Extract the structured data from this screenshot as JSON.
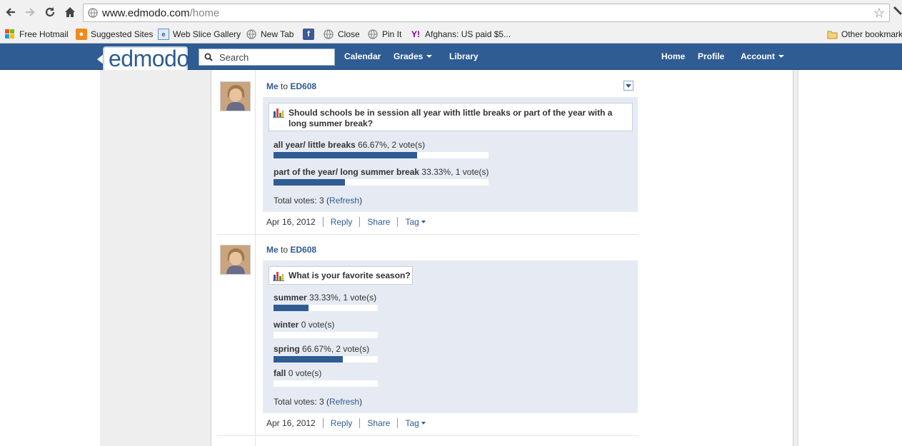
{
  "browser": {
    "url_host": "www.edmodo.com",
    "url_path": "/home",
    "bookmarks": [
      {
        "label": "Free Hotmail",
        "icon": "windows-icon"
      },
      {
        "label": "Suggested Sites",
        "icon": "suggested-sites-icon"
      },
      {
        "label": "Web Slice Gallery",
        "icon": "web-slice-icon"
      },
      {
        "label": "New Tab",
        "icon": "globe-icon"
      },
      {
        "label": "",
        "icon": "facebook-icon"
      },
      {
        "label": "Close",
        "icon": "globe-icon"
      },
      {
        "label": "Pin It",
        "icon": "globe-icon"
      },
      {
        "label": "Afghans: US paid $5...",
        "icon": "yahoo-icon"
      }
    ],
    "other_bookmarks": "Other bookmarks"
  },
  "header": {
    "logo": "edmodo",
    "search_placeholder": "Search",
    "nav_left": [
      "Calendar",
      "Grades",
      "Library"
    ],
    "nav_right": [
      "Home",
      "Profile",
      "Account"
    ]
  },
  "posts": [
    {
      "sender": "Me",
      "to_word": "to",
      "group": "ED608",
      "question": "Should schools be in session all year with little breaks or part of the year with a long summer break?",
      "options": [
        {
          "label": "all year/ little breaks",
          "stat": "66.67%, 2 vote(s)",
          "fraction": 0.6667
        },
        {
          "label": "part of the year/ long summer break",
          "stat": "33.33%, 1 vote(s)",
          "fraction": 0.3333
        }
      ],
      "total_prefix": "Total votes: 3 (",
      "refresh": "Refresh",
      "total_suffix": ")",
      "date": "Apr 16, 2012",
      "reply": "Reply",
      "share": "Share",
      "tag": "Tag"
    },
    {
      "sender": "Me",
      "to_word": "to",
      "group": "ED608",
      "question": "What is your favorite season?",
      "options": [
        {
          "label": "summer",
          "stat": "33.33%, 1 vote(s)",
          "fraction": 0.3333
        },
        {
          "label": "winter",
          "stat": "0 vote(s)",
          "fraction": 0
        },
        {
          "label": "spring",
          "stat": "66.67%, 2 vote(s)",
          "fraction": 0.6667
        },
        {
          "label": "fall",
          "stat": "0 vote(s)",
          "fraction": 0
        }
      ],
      "total_prefix": "Total votes: 3 (",
      "refresh": "Refresh",
      "total_suffix": ")",
      "date": "Apr 16, 2012",
      "reply": "Reply",
      "share": "Share",
      "tag": "Tag"
    }
  ],
  "colors": {
    "brand": "#2e5c93",
    "poll_bg": "#e6ebf3"
  }
}
